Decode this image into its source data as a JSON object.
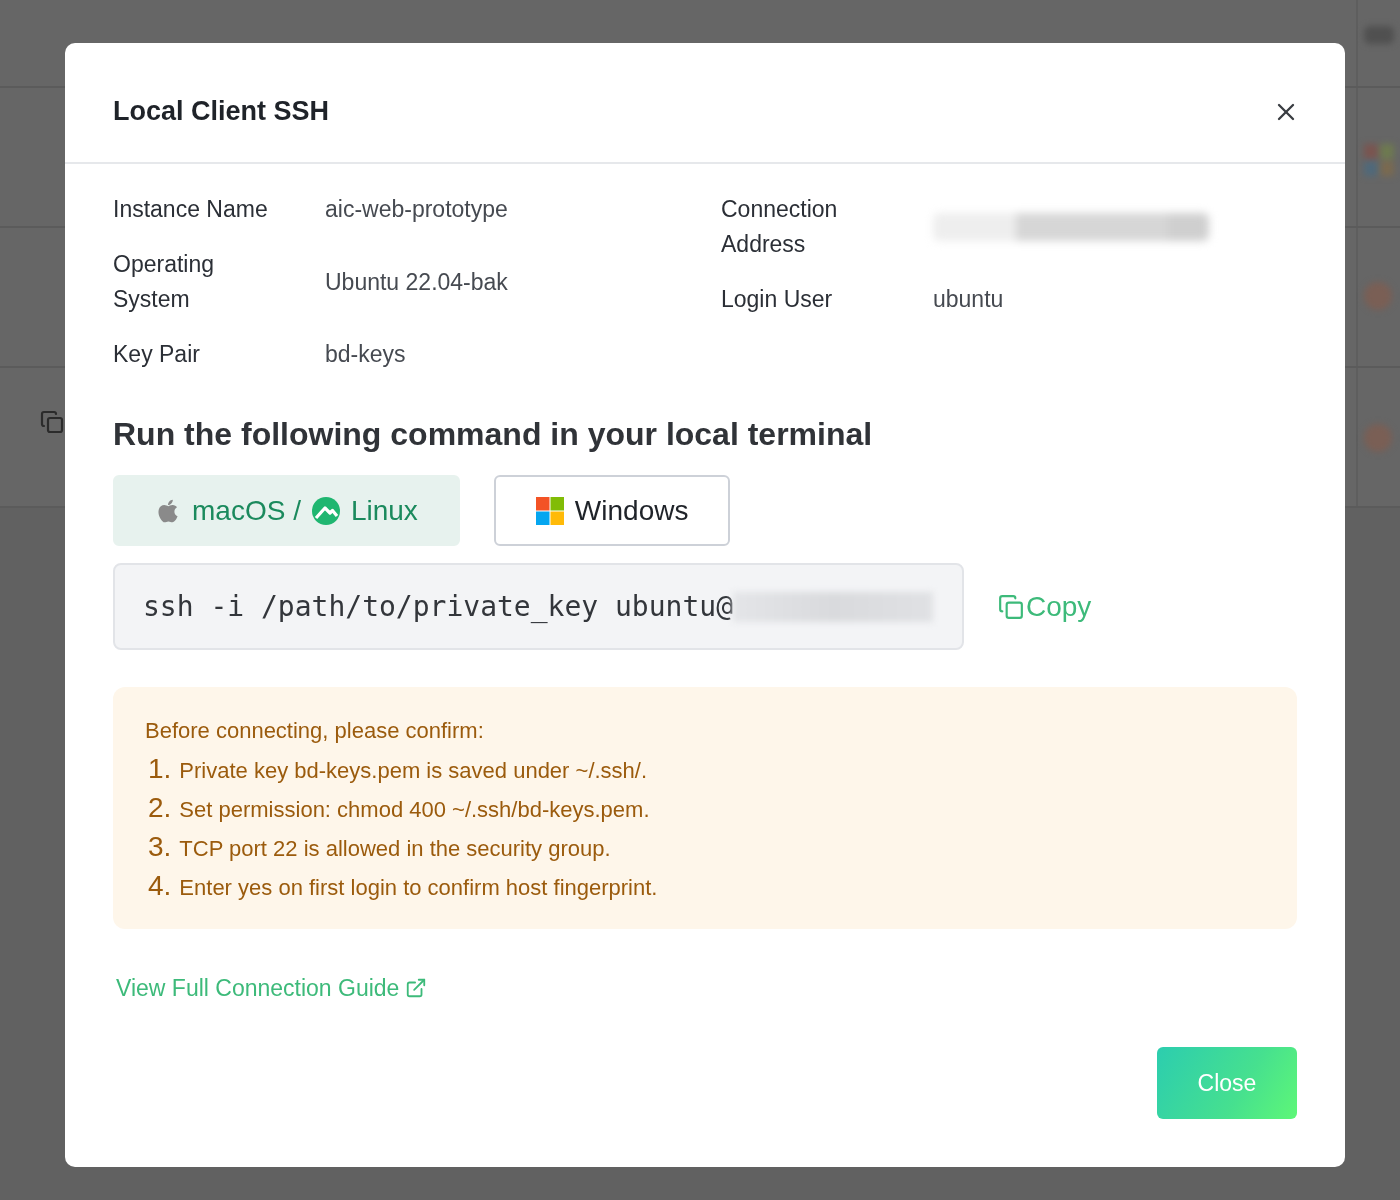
{
  "dialog": {
    "title": "Local Client SSH"
  },
  "details": {
    "left": [
      {
        "kind": "text",
        "label": "Instance Name",
        "value": "aic-web-prototype"
      },
      {
        "kind": "text",
        "label": "Operating System",
        "value": "Ubuntu 22.04-bak"
      },
      {
        "kind": "text",
        "label": "Key Pair",
        "value": "bd-keys"
      }
    ],
    "right": [
      {
        "kind": "redacted",
        "label": "Connection Address"
      },
      {
        "kind": "text",
        "label": "Login User",
        "value": "ubuntu"
      }
    ]
  },
  "command_section": {
    "heading": "Run the following command in your local terminal",
    "tabs": [
      {
        "kind": "unix",
        "labels": [
          "macOS /",
          "Linux"
        ],
        "selected": true
      },
      {
        "kind": "windows",
        "labels": [
          "Windows"
        ],
        "selected": false
      }
    ],
    "command": {
      "text": "ssh -i /path/to/private_key ubuntu@",
      "host_redacted": true
    },
    "copy_label": "Copy"
  },
  "notice": {
    "intro": "Before connecting, please confirm:",
    "items": [
      {
        "number": "1.",
        "text": "Private key bd-keys.pem is saved under ~/.ssh/."
      },
      {
        "number": "2.",
        "text": "Set permission: chmod 400 ~/.ssh/bd-keys.pem."
      },
      {
        "number": "3.",
        "text": "TCP port 22 is allowed in the security group."
      },
      {
        "number": "4.",
        "text": "Enter yes on first login to confirm host fingerprint."
      }
    ]
  },
  "guide_link": "View Full Connection Guide",
  "footer": {
    "close_button": "Close"
  }
}
